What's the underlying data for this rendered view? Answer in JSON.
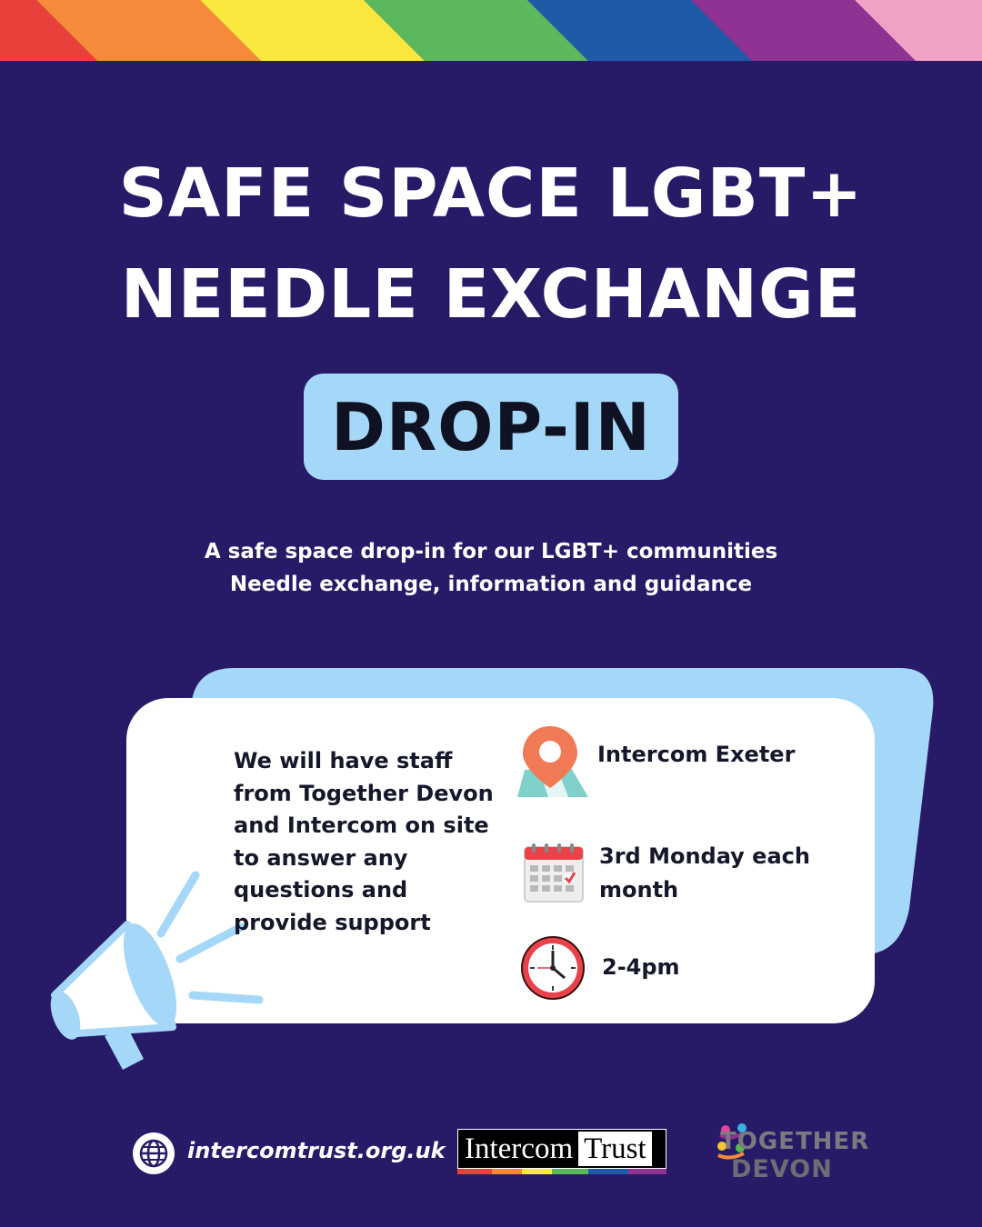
{
  "colors": {
    "background": "#271b68",
    "accent_light_blue": "#a5d8f8",
    "card": "#ffffff",
    "text_dark": "#15172a",
    "rainbow": [
      "#e8403a",
      "#f58a3a",
      "#fbe83f",
      "#5cb85c",
      "#1f5aa6",
      "#8e3294",
      "#f1a0c6"
    ]
  },
  "header": {
    "title_line1": "SAFE SPACE LGBT+",
    "title_line2": "NEEDLE EXCHANGE",
    "badge": "DROP-IN"
  },
  "subtitle": {
    "line1": "A safe space drop-in for our LGBT+ communities",
    "line2": "Needle exchange, information and guidance"
  },
  "card": {
    "staff_text": "We will have staff from Together Devon and Intercom on site to answer any questions and provide support",
    "location": "Intercom Exeter",
    "date": "3rd Monday each month",
    "time": "2-4pm",
    "icons": [
      "megaphone-icon",
      "map-pin-icon",
      "calendar-icon",
      "clock-icon"
    ]
  },
  "footer": {
    "website": "intercomtrust.org.uk",
    "logo_intercom_part1": "Intercom",
    "logo_intercom_part2": "Trust",
    "logo_together_line1": "TOGETHER",
    "logo_together_line2": "DEVON"
  }
}
